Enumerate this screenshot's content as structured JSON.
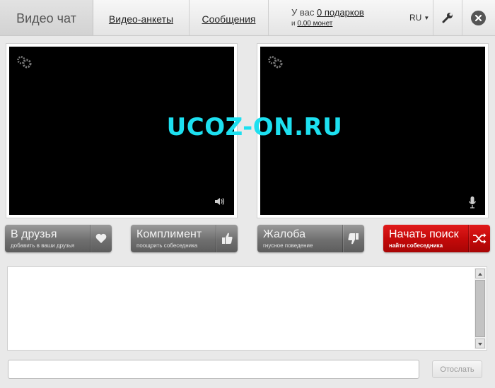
{
  "header": {
    "title": "Видео чат",
    "nav": [
      "Видео-анкеты",
      "Сообщения"
    ],
    "gifts_prefix": "У вас",
    "gifts_link": "0 подарков",
    "coins_prefix": "и",
    "coins_link": "0.00 монет",
    "lang": "RU"
  },
  "watermark": "UCOZ-ON.RU",
  "actions": {
    "friends": {
      "label": "В друзья",
      "sub": "добавить в ваши друзья"
    },
    "compliment": {
      "label": "Комплимент",
      "sub": "поощрить собеседника"
    },
    "complaint": {
      "label": "Жалоба",
      "sub": "гнусное поведение"
    },
    "search": {
      "label": "Начать поиск",
      "sub": "найти собеседника"
    }
  },
  "chat": {
    "input_value": "",
    "send_label": "Отослать"
  },
  "colors": {
    "accent_red": "#c80a0a",
    "watermark": "#1de0f0",
    "button_gray": "#6f6f6f"
  },
  "icons": [
    "gear-icon",
    "speaker-icon",
    "microphone-icon",
    "heart-icon",
    "thumbs-up-icon",
    "thumbs-down-icon",
    "shuffle-icon",
    "wrench-icon",
    "close-icon",
    "chevron-down-icon"
  ]
}
